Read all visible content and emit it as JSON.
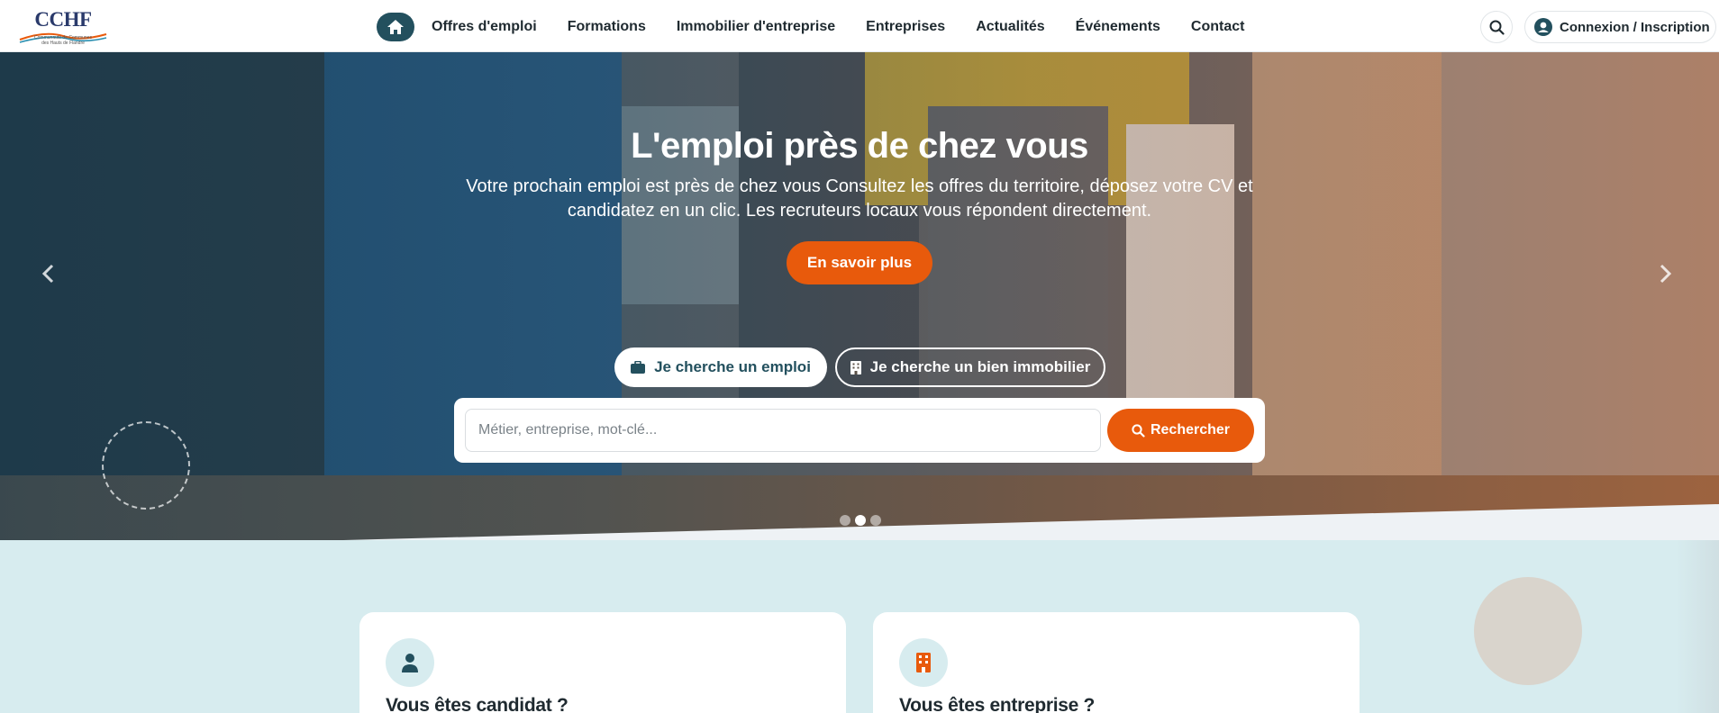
{
  "brand": {
    "logo_text": "CCHF",
    "logo_subtext": "Communauté de Communes des Hauts de Flandre"
  },
  "nav": {
    "home_icon": "home-icon",
    "items": [
      "Offres d'emploi",
      "Formations",
      "Immobilier d'entreprise",
      "Entreprises",
      "Actualités",
      "Événements",
      "Contact"
    ]
  },
  "header": {
    "search_icon": "search-icon",
    "login_label": "Connexion / Inscription",
    "login_icon": "user-circle-icon"
  },
  "hero": {
    "title": "L'emploi près de chez vous",
    "subtitle": "Votre prochain emploi est près de chez vous Consultez les offres du territoire, déposez votre CV et candidatez en un clic. Les recruteurs locaux vous répondent directement.",
    "cta_label": "En savoir plus",
    "prev_icon": "chevron-left-icon",
    "next_icon": "chevron-right-icon",
    "slides_count": 3,
    "active_slide": 2
  },
  "search": {
    "tab_job": "Je cherche un emploi",
    "tab_property": "Je cherche un bien immobilier",
    "active_tab": "job",
    "placeholder": "Métier, entreprise, mot-clé...",
    "value": "",
    "submit_label": "Rechercher"
  },
  "cards": [
    {
      "title": "Vous êtes candidat ?",
      "icon": "user-icon"
    },
    {
      "title": "Vous êtes entreprise ?",
      "icon": "building-icon"
    }
  ],
  "colors": {
    "primary": "#23505e",
    "accent": "#e85a0c",
    "section_bg": "#d7ecef"
  }
}
